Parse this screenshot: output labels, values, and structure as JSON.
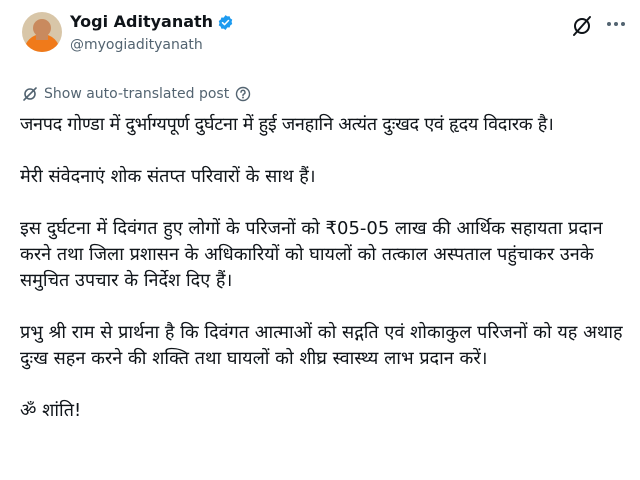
{
  "author": {
    "display_name": "Yogi Adityanath",
    "handle": "@myogiadityanath",
    "verified": true,
    "verified_color": "#1d9bf0"
  },
  "icons": {
    "avatar": "avatar-photo",
    "verified": "verified-badge-icon",
    "grok": "grok-icon",
    "more": "more-options-icon",
    "translate": "translate-globe-icon",
    "help": "help-circle-icon"
  },
  "translate": {
    "label": "Show auto-translated post"
  },
  "post": {
    "paragraphs": [
      "जनपद गोण्डा में दुर्भाग्यपूर्ण दुर्घटना में हुई जनहानि अत्यंत दुःखद एवं हृदय विदारक है।",
      "मेरी संवेदनाएं शोक संतप्त परिवारों के साथ हैं।",
      "इस दुर्घटना में दिवंगत हुए लोगों के परिजनों को ₹05-05 लाख की आर्थिक सहायता प्रदान करने तथा जिला प्रशासन के अधिकारियों को घायलों को तत्काल अस्पताल पहुंचाकर उनके समुचित उपचार के निर्देश दिए हैं।",
      "प्रभु श्री राम से प्रार्थना है कि दिवंगत आत्माओं को सद्गति एवं शोकाकुल परिजनों को यह अथाह दुःख सहन करने की शक्ति तथा घायलों को शीघ्र स्वास्थ्य लाभ प्रदान करें।",
      "ॐ शांति!"
    ]
  },
  "colors": {
    "text": "#0f1419",
    "secondary": "#536471",
    "accent": "#1d9bf0",
    "background": "#ffffff"
  }
}
